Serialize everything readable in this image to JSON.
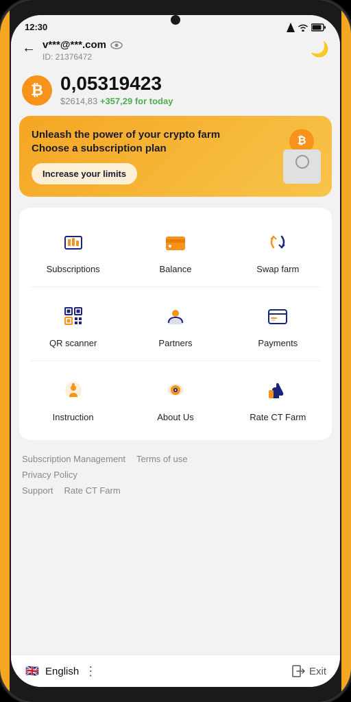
{
  "status": {
    "time": "12:30",
    "signal": "▲",
    "wifi": "wifi",
    "battery": "battery"
  },
  "header": {
    "back_label": "←",
    "email": "v***@***.com",
    "id_label": "ID: 21376472",
    "moon_icon": "🌙"
  },
  "balance": {
    "btc_symbol": "₿",
    "amount": "0,05319423",
    "usd": "$2614,83",
    "today_change": "+357,29 for today"
  },
  "banner": {
    "title": "Unleash the power of your crypto farm\nChoose a subscription plan",
    "button_label": "Increase your limits",
    "coin_symbol": "₿"
  },
  "grid": {
    "items": [
      {
        "id": "subscriptions",
        "label": "Subscriptions"
      },
      {
        "id": "balance",
        "label": "Balance"
      },
      {
        "id": "swap-farm",
        "label": "Swap farm"
      },
      {
        "id": "qr-scanner",
        "label": "QR scanner"
      },
      {
        "id": "partners",
        "label": "Partners"
      },
      {
        "id": "payments",
        "label": "Payments"
      },
      {
        "id": "instruction",
        "label": "Instruction"
      },
      {
        "id": "about-us",
        "label": "About Us"
      },
      {
        "id": "rate-ct-farm",
        "label": "Rate CT Farm"
      }
    ]
  },
  "footer": {
    "links": [
      {
        "id": "subscription-management",
        "label": "Subscription Management"
      },
      {
        "id": "terms-of-use",
        "label": "Terms of use"
      },
      {
        "id": "privacy-policy",
        "label": "Privacy Policy"
      },
      {
        "id": "support",
        "label": "Support"
      },
      {
        "id": "rate-ct-farm",
        "label": "Rate CT Farm"
      }
    ]
  },
  "bottom_bar": {
    "language": "English",
    "dots": "⋮",
    "exit_label": "Exit",
    "flag": "🇬🇧"
  }
}
